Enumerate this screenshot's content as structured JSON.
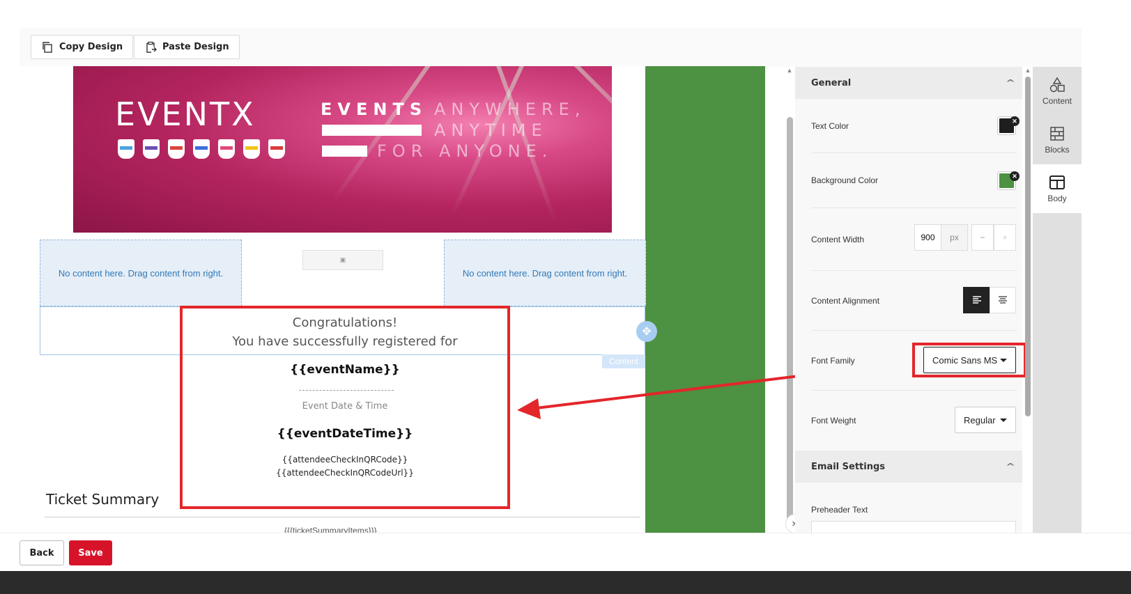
{
  "toolbar": {
    "copy_label": "Copy Design",
    "paste_label": "Paste Design"
  },
  "banner": {
    "logo_text": "EVENTX",
    "tag_words": [
      "EVENTS",
      "ANYWHERE,",
      "ANYTIME",
      "FOR ANYONE."
    ]
  },
  "canvas": {
    "drop_left": "No content here. Drag content from right.",
    "drop_right": "No content here. Drag content from right.",
    "content_tag": "Content",
    "congrats_line1": "Congratulations!",
    "congrats_line2": "You have successfully registered for",
    "event_name": "{{eventName}}",
    "date_label": "Event Date & Time",
    "event_datetime": "{{eventDateTime}}",
    "qr_code": "{{attendeeCheckInQRCode}}",
    "qr_code_url": "{{attendeeCheckInQRCodeUrl}}",
    "ticket_title": "Ticket Summary",
    "ticket_items": "{{{ticketSummaryItems}}}"
  },
  "panel": {
    "general_title": "General",
    "text_color_label": "Text Color",
    "text_color_value": "#1e1e1e",
    "bg_color_label": "Background Color",
    "bg_color_value": "#4d9142",
    "content_width_label": "Content Width",
    "content_width_value": "900",
    "content_width_unit": "px",
    "minus": "−",
    "plus": "+",
    "content_alignment_label": "Content Alignment",
    "font_family_label": "Font Family",
    "font_family_value": "Comic Sans MS",
    "font_weight_label": "Font Weight",
    "font_weight_value": "Regular",
    "email_settings_title": "Email Settings",
    "preheader_label": "Preheader Text",
    "preheader_value": ""
  },
  "rail": {
    "content": "Content",
    "blocks": "Blocks",
    "body": "Body"
  },
  "footer": {
    "back_label": "Back",
    "save_label": "Save"
  },
  "colors": {
    "accent_red": "#d7132a",
    "annotation_red": "#e3262a",
    "canvas_green": "#4d9142"
  }
}
